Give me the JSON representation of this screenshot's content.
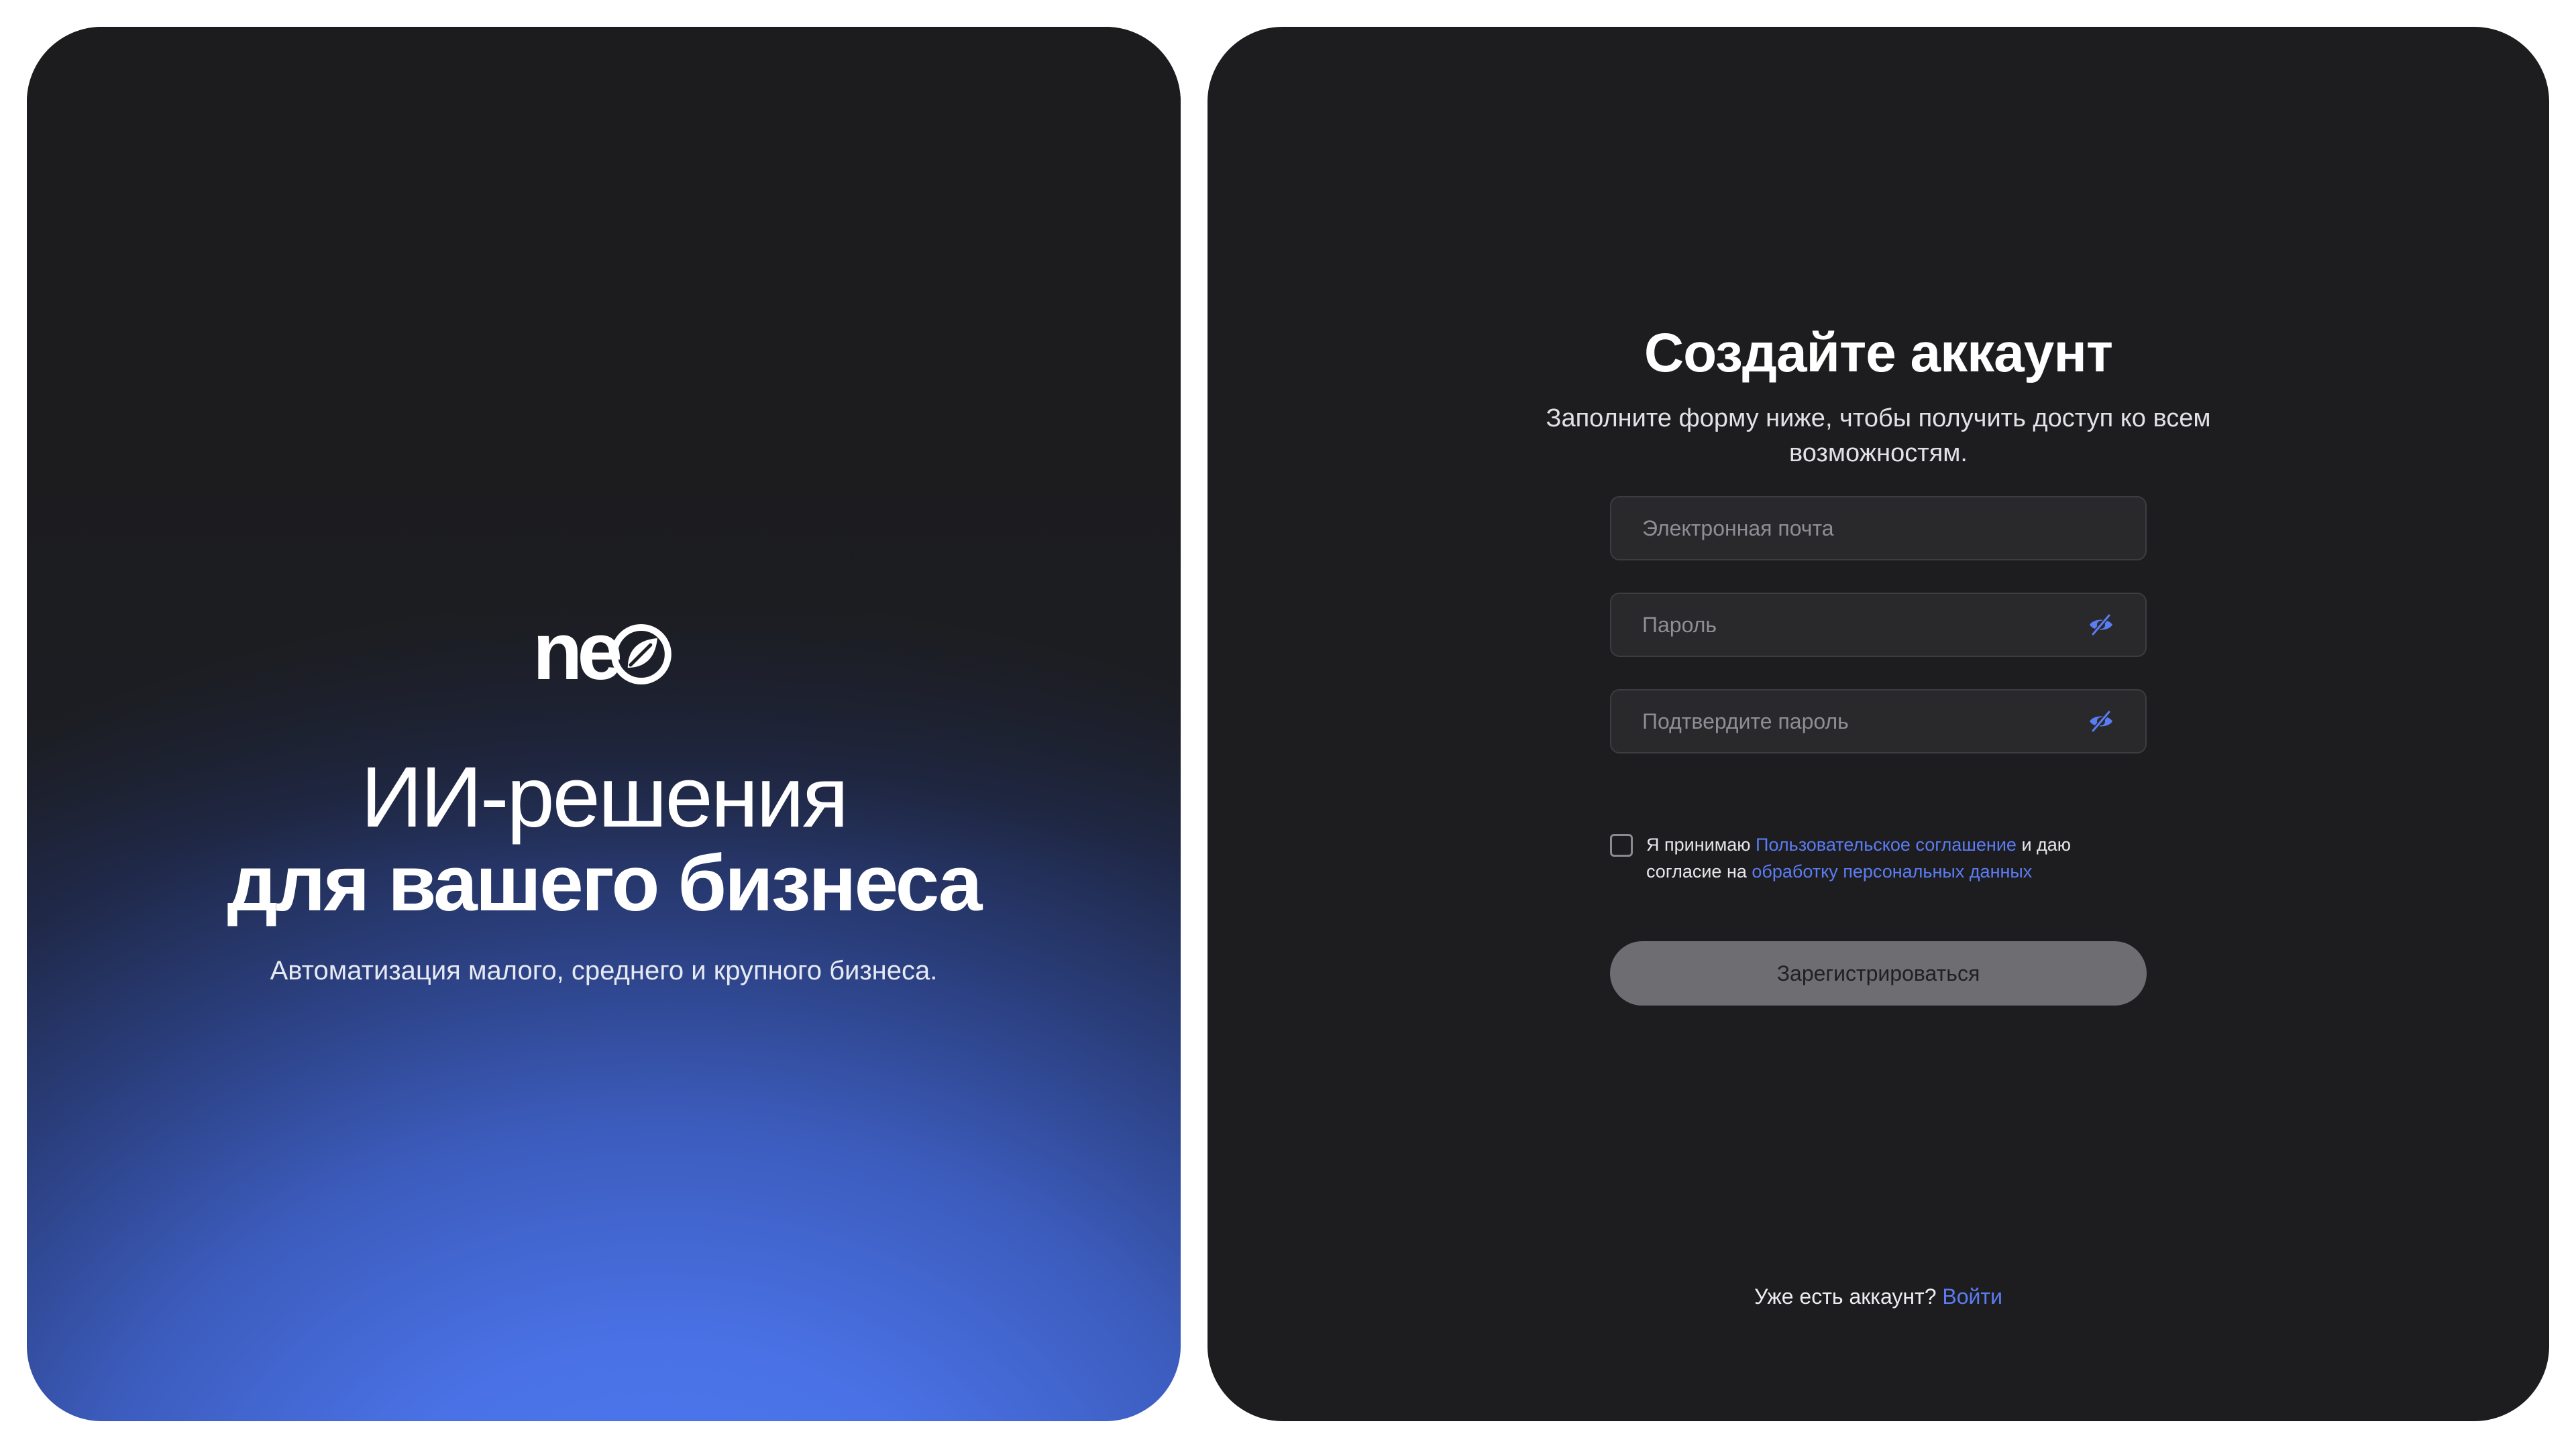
{
  "brand": {
    "logo_text": "ne",
    "accent_color": "#4d79f4"
  },
  "hero": {
    "headline_line1": "ИИ-решения",
    "headline_line2": "для вашего бизнеса",
    "subtitle": "Автоматизация малого, среднего и крупного бизнеса."
  },
  "form": {
    "title": "Создайте аккаунт",
    "subtitle": "Заполните форму ниже, чтобы получить доступ ко всем возможностям.",
    "email_placeholder": "Электронная почта",
    "password_placeholder": "Пароль",
    "confirm_placeholder": "Подтвердите пароль",
    "password_toggle_icon": "eye-slash-icon",
    "consent": {
      "prefix": "Я принимаю ",
      "terms_link": "Пользовательское соглашение",
      "middle": " и даю согласие на ",
      "privacy_link": "обработку персональных данных",
      "checked": false
    },
    "submit_label": "Зарегистрироваться"
  },
  "footer": {
    "question": "Уже есть аккаунт?",
    "signin_link": "Войти"
  },
  "colors": {
    "panel_background": "#1d1d1f",
    "field_background": "#29292c",
    "link": "#5b7cf2",
    "button_disabled": "#6d6d72"
  }
}
